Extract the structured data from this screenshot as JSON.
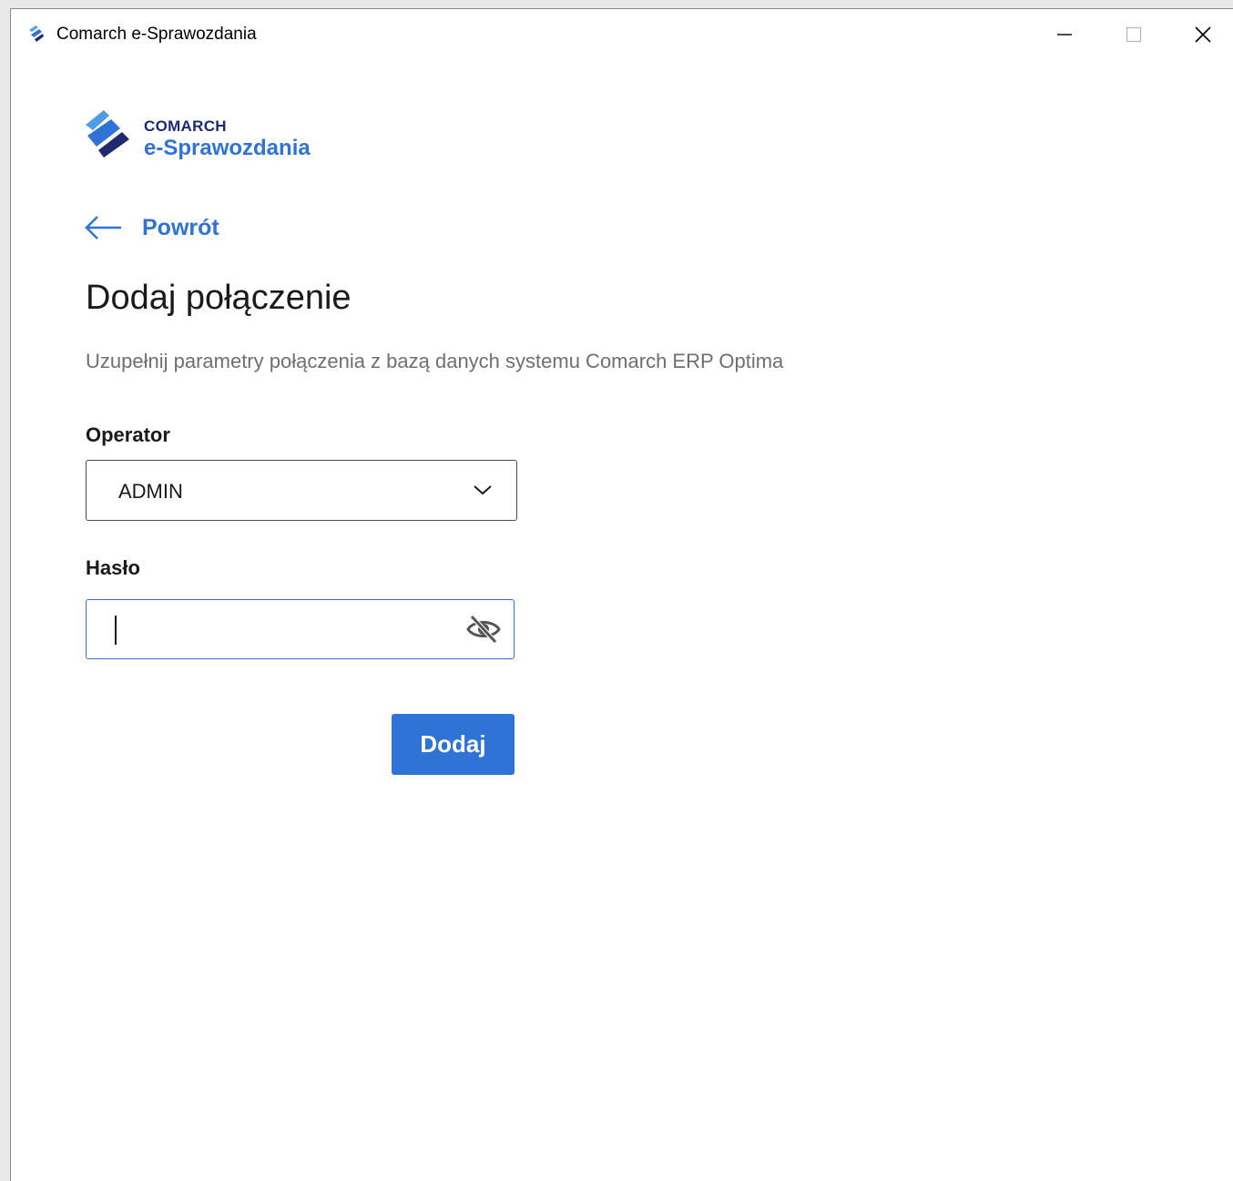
{
  "window": {
    "title": "Comarch e-Sprawozdania",
    "controls": [
      "minimize",
      "maximize",
      "close"
    ]
  },
  "logo": {
    "brand": "COMARCH",
    "product": "e-Sprawozdania"
  },
  "nav": {
    "back_label": "Powrót"
  },
  "page": {
    "title": "Dodaj połączenie",
    "subtitle": "Uzupełnij parametry połączenia z bazą danych systemu  Comarch ERP Optima"
  },
  "form": {
    "operator_label": "Operator",
    "operator_value": "ADMIN",
    "password_label": "Hasło",
    "password_value": "",
    "submit_label": "Dodaj"
  },
  "icons": {
    "app": "comarch-logo-icon",
    "back": "arrow-left-icon",
    "dropdown": "chevron-down-icon",
    "visibility": "eye-off-icon"
  },
  "colors": {
    "accent": "#2f73d6",
    "brand_dark": "#1e2a6e",
    "text": "#1a1a1a",
    "muted": "#6f6f6f"
  }
}
